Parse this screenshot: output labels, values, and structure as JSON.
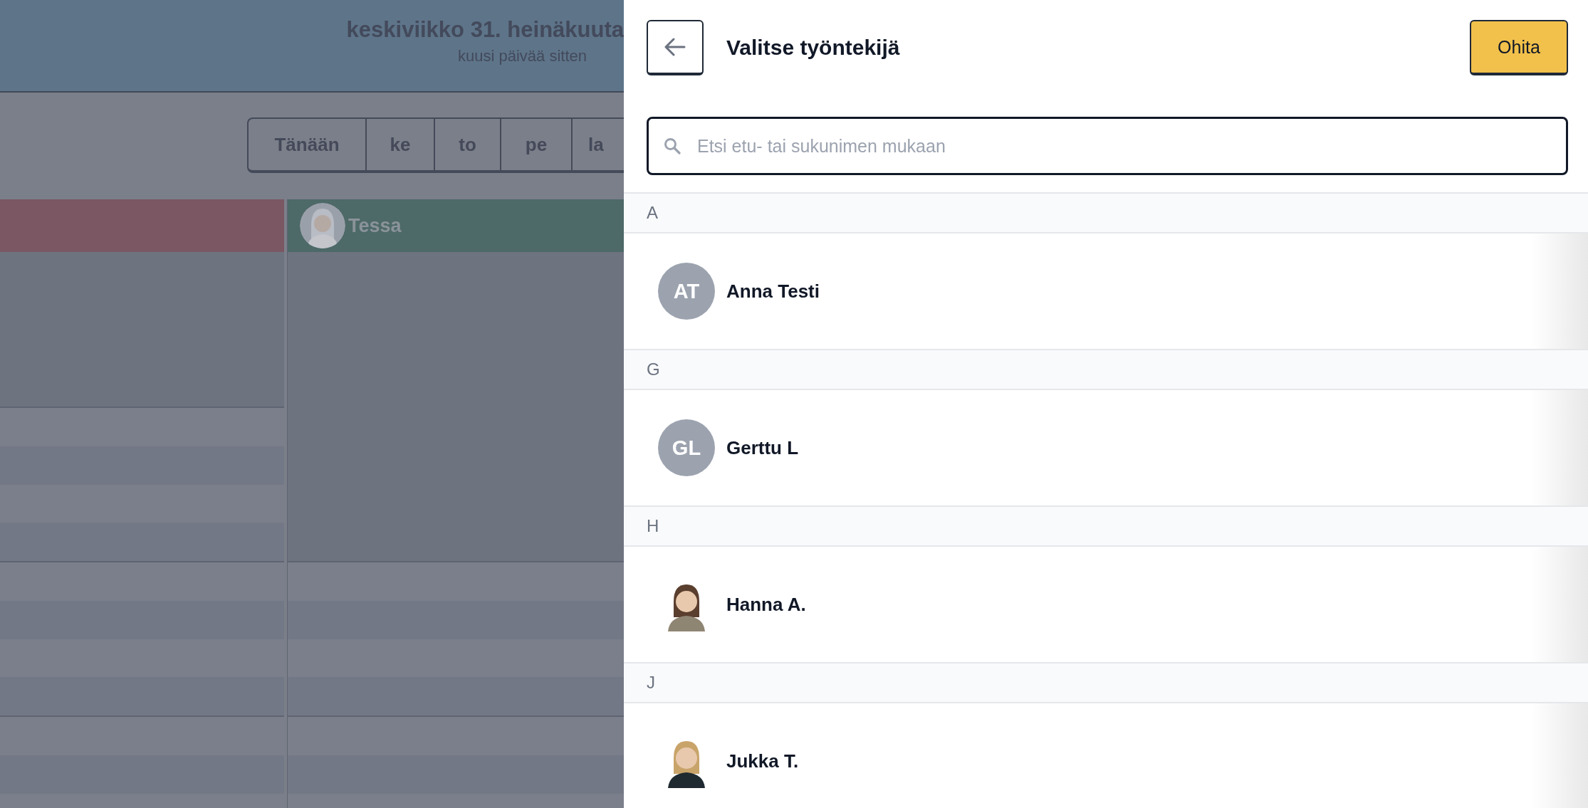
{
  "calendar": {
    "date_title": "keskiviikko 31. heinäkuuta",
    "relative_date": "kuusi päivää sitten",
    "day_tabs": [
      "Tänään",
      "ke",
      "to",
      "pe",
      "la"
    ],
    "columns": [
      {
        "color": "#7a5763",
        "blocks": [
          {
            "kind": "blocked"
          },
          {
            "kind": "open"
          },
          {
            "kind": "open"
          },
          {
            "kind": "open"
          }
        ]
      },
      {
        "color": "#4d6968",
        "name": "Tessa",
        "avatar": {
          "kind": "picture"
        },
        "blocks": [
          {
            "kind": "blocked"
          },
          {
            "kind": "blocked"
          },
          {
            "kind": "open"
          },
          {
            "kind": "open"
          }
        ]
      }
    ]
  },
  "picker": {
    "title": "Valitse työntekijä",
    "skip_button": "Ohita",
    "search": {
      "placeholder": "Etsi etu- tai sukunimen mukaan"
    },
    "groups": [
      {
        "letter": "A",
        "people": [
          {
            "name": "Anna Testi",
            "kind": "initials",
            "initials": "AT"
          }
        ]
      },
      {
        "letter": "G",
        "people": [
          {
            "name": "Gerttu L",
            "kind": "initials",
            "initials": "GL"
          }
        ]
      },
      {
        "letter": "H",
        "people": [
          {
            "name": "Hanna A.",
            "kind": "picture"
          }
        ]
      },
      {
        "letter": "J",
        "people": [
          {
            "name": "Jukka T.",
            "kind": "picture"
          }
        ]
      }
    ]
  }
}
